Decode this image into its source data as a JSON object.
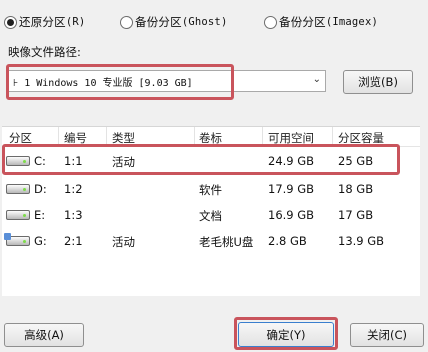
{
  "mode_options": [
    {
      "label": "还原分区",
      "shortcut": "(R)",
      "selected": true
    },
    {
      "label": "备份分区",
      "shortcut": "(Ghost)",
      "selected": false
    },
    {
      "label": "备份分区",
      "shortcut": "(Imagex)",
      "selected": false
    }
  ],
  "image_path_label": "映像文件路径:",
  "image_path_value": "⊦ 1 Windows 10 专业版 [9.03 GB]",
  "browse_label": "浏览(B)",
  "table": {
    "headers": [
      "分区",
      "编号",
      "类型",
      "卷标",
      "可用空间",
      "分区容量"
    ],
    "rows": [
      {
        "drive": "C:",
        "number": "1:1",
        "type": "活动",
        "label": "",
        "free": "24.9 GB",
        "capacity": "25 GB",
        "usb": false
      },
      {
        "drive": "D:",
        "number": "1:2",
        "type": "",
        "label": "软件",
        "free": "17.9 GB",
        "capacity": "18 GB",
        "usb": false
      },
      {
        "drive": "E:",
        "number": "1:3",
        "type": "",
        "label": "文档",
        "free": "16.9 GB",
        "capacity": "17 GB",
        "usb": false
      },
      {
        "drive": "G:",
        "number": "2:1",
        "type": "活动",
        "label": "老毛桃U盘",
        "free": "2.8 GB",
        "capacity": "13.9 GB",
        "usb": true
      }
    ]
  },
  "advanced_label": "高级(A)",
  "ok_label": "确定(Y)",
  "close_label": "关闭(C)",
  "colors": {
    "highlight": "#c9545c",
    "window_bg": "#f0f0f0"
  }
}
